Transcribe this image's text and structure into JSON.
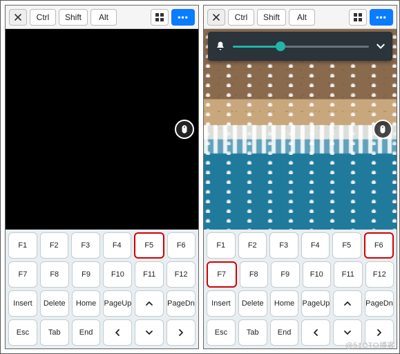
{
  "topbar": {
    "ctrl": "Ctrl",
    "shift": "Shift",
    "alt": "Alt",
    "more": "•••"
  },
  "keys": {
    "f1": "F1",
    "f2": "F2",
    "f3": "F3",
    "f4": "F4",
    "f5": "F5",
    "f6": "F6",
    "f7": "F7",
    "f8": "F8",
    "f9": "F9",
    "f10": "F10",
    "f11": "F11",
    "f12": "F12",
    "insert": "Insert",
    "delete": "Delete",
    "home": "Home",
    "pageup": "PageUp",
    "pagedn": "PageDn",
    "esc": "Esc",
    "tab": "Tab",
    "end": "End"
  },
  "highlight": {
    "left": "F5",
    "right_a": "F6",
    "right_b": "F7"
  },
  "slider": {
    "percent": 35
  },
  "watermark": "@51CTO博客"
}
